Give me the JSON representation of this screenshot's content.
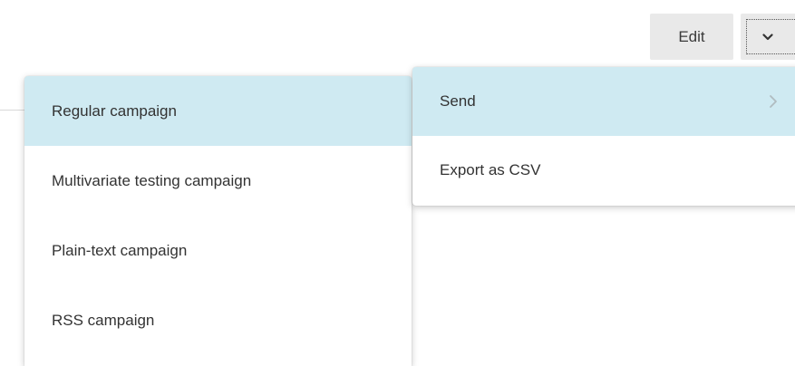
{
  "toolbar": {
    "edit_label": "Edit",
    "dropdown_icon": "chevron-down-icon"
  },
  "campaign_menu": {
    "items": [
      {
        "label": "Regular campaign",
        "active": true
      },
      {
        "label": "Multivariate testing campaign",
        "active": false
      },
      {
        "label": "Plain-text campaign",
        "active": false
      },
      {
        "label": "RSS campaign",
        "active": false
      }
    ]
  },
  "action_menu": {
    "items": [
      {
        "label": "Send",
        "active": true,
        "has_submenu": true,
        "icon": "chevron-right-icon"
      },
      {
        "label": "Export as CSV",
        "active": false,
        "has_submenu": false
      }
    ]
  },
  "colors": {
    "active_item_bg": "#cfeaf2",
    "button_bg": "#e9e9e9",
    "text": "#333333"
  }
}
